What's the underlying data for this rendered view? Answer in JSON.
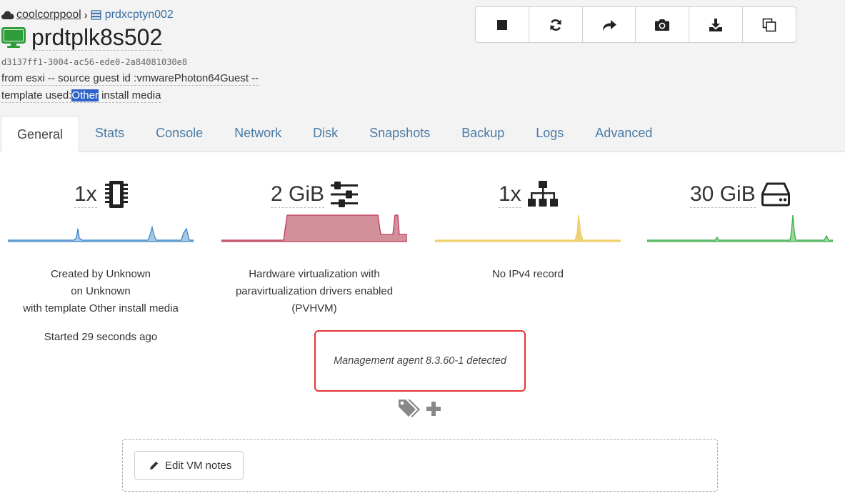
{
  "breadcrumb": {
    "pool": "coolcorppool",
    "host": "prdxcptyn002"
  },
  "vm": {
    "name": "prdtplk8s502",
    "uuid": "d3137ff1-3004-ac56-ede0-2a84081030e8",
    "description": "from esxi -- source guest id :vmwarePhoton64Guest --",
    "template_prefix": "template used:",
    "template_highlight": "Other",
    "template_suffix": " install media"
  },
  "toolbar": [
    "stop-icon",
    "refresh-icon",
    "migrate-icon",
    "snapshot-icon",
    "export-icon",
    "copy-icon"
  ],
  "tabs": [
    "General",
    "Stats",
    "Console",
    "Network",
    "Disk",
    "Snapshots",
    "Backup",
    "Logs",
    "Advanced"
  ],
  "active_tab": "General",
  "stats": {
    "cpu": {
      "value": "1x",
      "icon": "cpu-icon",
      "color": "#3a86c8"
    },
    "memory": {
      "value": "2 GiB",
      "icon": "sliders-icon",
      "color": "#c0395b"
    },
    "network": {
      "value": "1x",
      "icon": "network-icon",
      "color": "#f0d060"
    },
    "disk": {
      "value": "30 GiB",
      "icon": "hdd-icon",
      "color": "#3cb04a"
    }
  },
  "info": {
    "created_line1": "Created by Unknown",
    "created_line2": "on Unknown",
    "created_line3": "with template Other install media",
    "started": "Started 29 seconds ago",
    "virt_line1": "Hardware virtualization with",
    "virt_line2": "paravirtualization drivers enabled",
    "virt_line3": "(PVHVM)",
    "ipv4": "No IPv4 record",
    "agent": "Management agent 8.3.60-1 detected"
  },
  "notes": {
    "edit_label": "Edit VM notes"
  }
}
